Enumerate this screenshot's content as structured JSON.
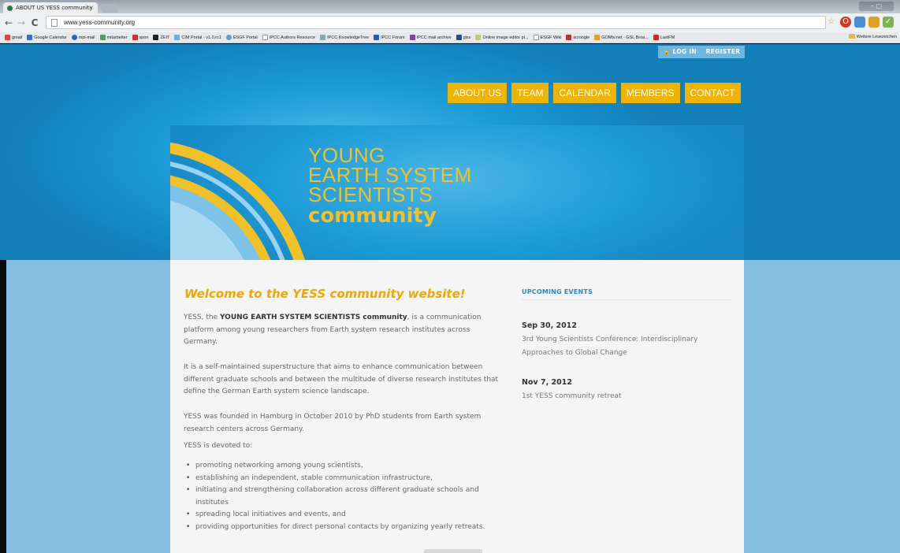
{
  "browser": {
    "tab_title": "ABOUT US YESS community",
    "tab_close": "×",
    "url": "www.yess-community.org",
    "bookmarks": [
      "gmail",
      "Google Calendar",
      "mpi-mail",
      "mitarbeiter",
      "spon",
      "ZEIT",
      "CIM Portal - v1.0.rc1",
      "ESGF Portal",
      "IPCC Authors Resource",
      "IPCC KnowledgeTree",
      "IPCC Forum",
      "IPCC mail archive",
      "giss",
      "Online image editor pi...",
      "ESGF Wiki",
      "scroogle",
      "GOMtv.net - GSL Broa...",
      "LastFM"
    ],
    "bookmarks_more": "»",
    "bookmarks_folder": "Weitere Lesezeichen"
  },
  "site": {
    "topbar": {
      "login": "LOG IN",
      "register": "REGISTER"
    },
    "nav": [
      "ABOUT US",
      "TEAM",
      "CALENDAR",
      "MEMBERS",
      "CONTACT"
    ],
    "logo": {
      "line1": "YOUNG",
      "line2": "EARTH SYSTEM",
      "line3": "SCIENTISTS",
      "line4": "community"
    },
    "welcome_heading": "Welcome to the YESS community website!",
    "intro_pre": "YESS, the ",
    "intro_bold": "YOUNG EARTH SYSTEM SCIENTISTS community",
    "intro_post": ", is a communication platform among young researchers from Earth system research institutes across Germany.",
    "para2": "It is a self-maintained superstructure that aims to enhance communication between different graduate schools and between the multitude of diverse research institutes that define the German Earth system science landscape.",
    "para3": "YESS was founded in Hamburg in October 2010 by PhD students from Earth system research centers across Germany.",
    "para4": "YESS is devoted to:",
    "bullets": [
      "promoting networking among young scientists,",
      "establishing an independent, stable communication infrastructure,",
      "initiating and strengthening collaboration across different graduate schools and institutes",
      "spreading local initiatives and events, and",
      "providing opportunities for direct personal contacts by organizing yearly retreats."
    ],
    "events": {
      "heading": "UPCOMING EVENTS",
      "items": [
        {
          "date": "Sep 30, 2012",
          "title": "3rd Young Scientists Conference: Interdisciplinary Approaches to Global Change"
        },
        {
          "date": "Nov 7, 2012",
          "title": "1st YESS community retreat"
        }
      ]
    }
  },
  "colors": {
    "accent": "#f0b400",
    "hero_blue": "#1a9ad6",
    "lower_blue": "#83bde0",
    "events_heading": "#2a88c4"
  }
}
